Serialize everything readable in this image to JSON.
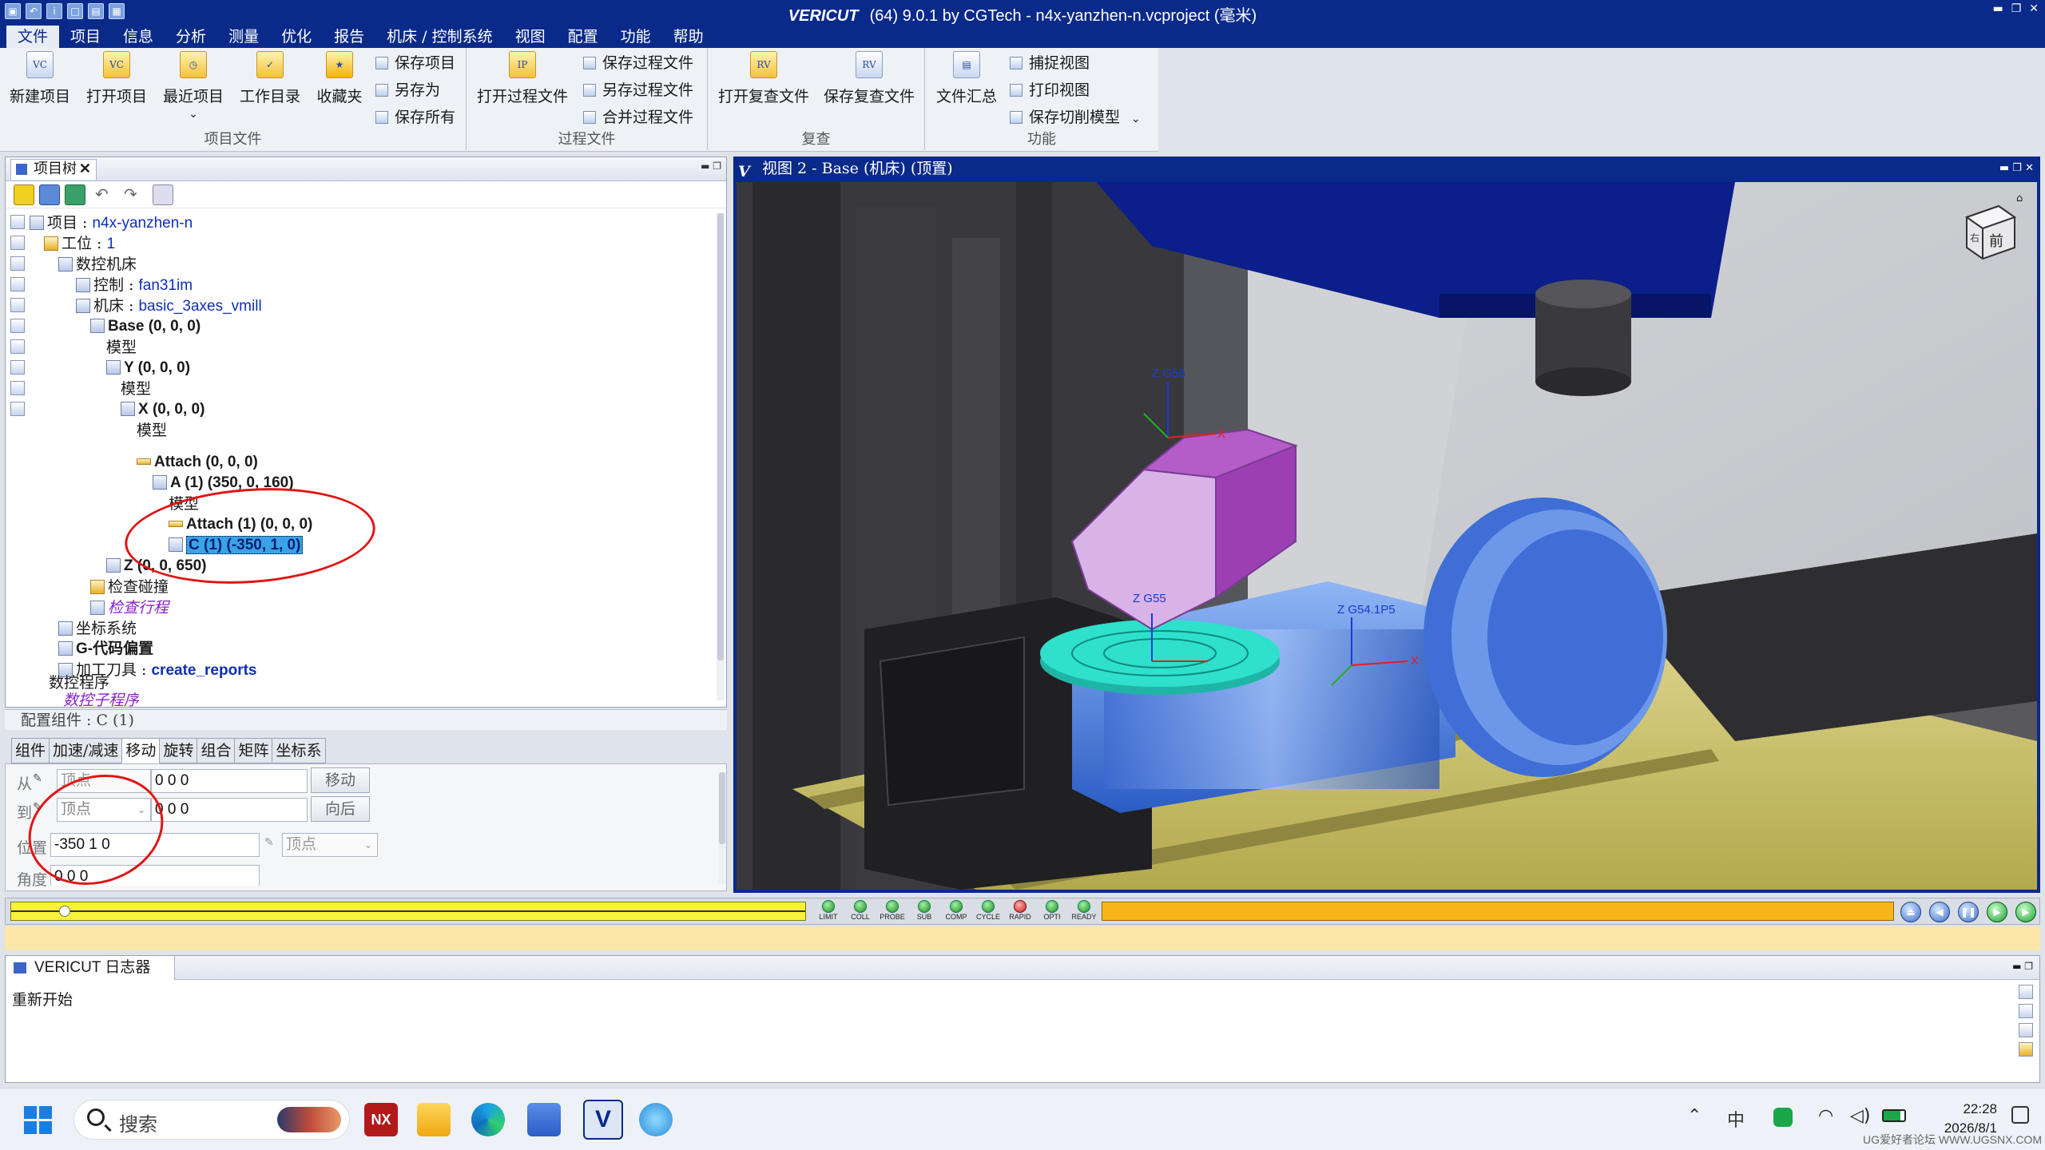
{
  "app": {
    "title_brand": "VERICUT",
    "title_rest": "(64)  9.0.1 by CGTech - n4x-yanzhen-n.vcproject (毫米)"
  },
  "menu": [
    "文件",
    "项目",
    "信息",
    "分析",
    "测量",
    "优化",
    "报告",
    "机床 / 控制系统",
    "视图",
    "配置",
    "功能",
    "帮助"
  ],
  "ribbon": {
    "project_files": {
      "group": "项目文件",
      "new": "新建项目",
      "open": "打开项目",
      "recent": "最近项目",
      "workdir": "工作目录",
      "favorites": "收藏夹",
      "save": "保存项目",
      "saveas": "另存为",
      "saveall": "保存所有"
    },
    "process_files": {
      "group": "过程文件",
      "open": "打开过程文件",
      "save": "保存过程文件",
      "saveas": "另存过程文件",
      "merge": "合并过程文件"
    },
    "review": {
      "group": "复查",
      "open": "打开复查文件",
      "save": "保存复查文件"
    },
    "functions": {
      "group": "功能",
      "summary": "文件汇总",
      "capture": "捕捉视图",
      "print": "打印视图",
      "save_cut": "保存切削模型"
    }
  },
  "tree_panel": {
    "tab": "项目树",
    "nodes": [
      {
        "label": "项目 : ",
        "value": "n4x-yanzhen-n"
      },
      {
        "label": "工位 : ",
        "value": "1"
      },
      {
        "label": "数控机床",
        "value": ""
      },
      {
        "label": "控制 : ",
        "value": "fan31im"
      },
      {
        "label": "机床 : ",
        "value": "basic_3axes_vmill"
      },
      {
        "label": "Base (0, 0, 0)",
        "value": ""
      },
      {
        "label": "模型",
        "value": ""
      },
      {
        "label": "Y (0, 0, 0)",
        "value": ""
      },
      {
        "label": "模型",
        "value": ""
      },
      {
        "label": "X (0, 0, 0)",
        "value": ""
      },
      {
        "label": "模型",
        "value": ""
      },
      {
        "label": "Attach (0, 0, 0)",
        "value": ""
      },
      {
        "label": "A (1) (350, 0, 160)",
        "value": ""
      },
      {
        "label": "模型",
        "value": ""
      },
      {
        "label": "Attach (1) (0, 0, 0)",
        "value": ""
      },
      {
        "label": "C (1) (-350, 1, 0)",
        "value": ""
      },
      {
        "label": "Z (0, 0, 650)",
        "value": ""
      },
      {
        "label": "检查碰撞",
        "value": ""
      },
      {
        "label": "检查行程",
        "value": ""
      },
      {
        "label": "坐标系统",
        "value": ""
      },
      {
        "label": "G-代码偏置",
        "value": ""
      },
      {
        "label": "加工刀具 : ",
        "value": "create_reports"
      },
      {
        "label": "数控程序",
        "value": ""
      },
      {
        "label": "数控子程序",
        "value": ""
      }
    ]
  },
  "config": {
    "header": "配置组件 : C (1)",
    "tabs": [
      "组件",
      "加速/减速",
      "移动",
      "旋转",
      "组合",
      "矩阵",
      "坐标系"
    ],
    "active_tab": "移动",
    "from_label": "从",
    "from_type": "顶点",
    "from_value": "0 0 0",
    "move_btn": "移动",
    "to_label": "到",
    "to_type": "顶点",
    "to_value": "0 0 0",
    "back_btn": "向后",
    "pos_label": "位置",
    "pos_value": "-350 1 0",
    "pos_type": "顶点",
    "angle_label": "角度",
    "angle_value": "0 0 0"
  },
  "view": {
    "title": "视图 2 - Base (机床) (顶置)",
    "labels": {
      "g56": "Z G56",
      "g55": "Z G55",
      "g54": "Z G54.1P5",
      "x": "X",
      "y": "Y"
    },
    "cube_face": "前",
    "cube_side": "右"
  },
  "sim": {
    "leds": [
      {
        "name": "LIMIT",
        "color": "green"
      },
      {
        "name": "COLL",
        "color": "green"
      },
      {
        "name": "PROBE",
        "color": "green"
      },
      {
        "name": "SUB",
        "color": "green"
      },
      {
        "name": "COMP",
        "color": "green"
      },
      {
        "name": "CYCLE",
        "color": "green"
      },
      {
        "name": "RAPID",
        "color": "red"
      },
      {
        "name": "OPTI",
        "color": "green"
      },
      {
        "name": "READY",
        "color": "green"
      }
    ]
  },
  "logger": {
    "tab": "VERICUT 日志器",
    "text": "重新开始"
  },
  "taskbar": {
    "search": "搜索",
    "ime": "中",
    "time": "22:28",
    "date": "2026/8/1",
    "watermark": "UG爱好者论坛 WWW.UGSNX.COM"
  }
}
